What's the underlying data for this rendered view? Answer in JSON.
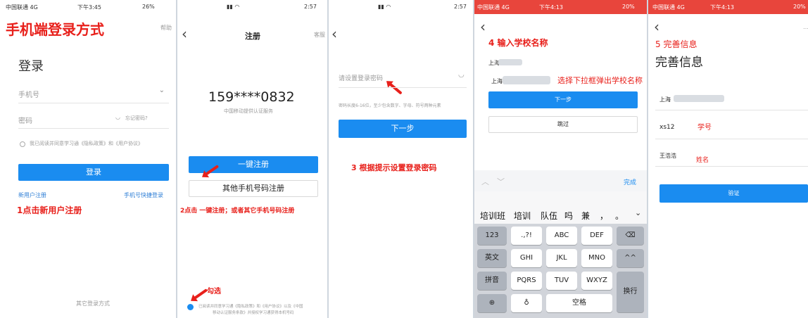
{
  "panel1": {
    "status_left": "中国联通 4G",
    "status_time": "下午3:45",
    "status_right": "26%",
    "header_annotation": "手机端登录方式",
    "top_right_link": "帮助",
    "title": "登录",
    "phone_placeholder": "手机号",
    "password_placeholder": "密码",
    "forgot_password": "忘记密码?",
    "agreement": "我已阅读并同意学习通《隐私政策》和《用户协议》",
    "login_button": "登录",
    "new_user_link": "新用户注册",
    "phone_code_login": "手机号快捷登录",
    "step_annotation": "1点击新用户注册",
    "other_login": "其它登录方式"
  },
  "panel2": {
    "status_right": "2:57",
    "title": "注册",
    "help": "客服",
    "phone_number": "159****0832",
    "carrier_note": "中国移动提供认证服务",
    "one_click_register": "一键注册",
    "other_phone_register": "其他手机号码注册",
    "step_annotation": "2点击 一键注册；或者其它手机号码注册",
    "check_annotation": "勾选",
    "agreement_line1": "已阅读并同意学习通《隐私政策》和《用户协议》以及《中国",
    "agreement_line2": "移动认证服务条款》并授权学习通获得本机号码"
  },
  "panel3": {
    "status_right": "2:57",
    "password_placeholder": "请设置登录密码",
    "password_hint": "密码长度6-16位，至少包含数字、字母、符号两种元素",
    "next_button": "下一步",
    "step_annotation": "3 根据提示设置登录密码"
  },
  "panel4": {
    "status_left": "中国联通 4G",
    "status_time": "下午4:13",
    "status_right": "20%",
    "step_annotation": "4 输入学校名称",
    "school_label": "上海",
    "school_input_prefix": "上海",
    "dropdown_annotation": "选择下拉框弹出学校名称",
    "next_button": "下一步",
    "skip_button": "跳过",
    "keyboard_done": "完成",
    "candidates": [
      "培训班",
      "培训",
      "队伍",
      "吗",
      "兼",
      "，",
      "。"
    ],
    "keys_row1": [
      "123",
      ".,?!",
      "ABC",
      "DEF"
    ],
    "keys_row2": [
      "英文",
      "GHI",
      "JKL",
      "MNO",
      "^^"
    ],
    "keys_row3": [
      "拼音",
      "PQRS",
      "TUV",
      "WXYZ"
    ],
    "space_key": "空格",
    "enter_key": "换行"
  },
  "panel5": {
    "status_left": "中国联通 4G",
    "status_time": "下午4:13",
    "status_right": "20%",
    "step_annotation": "5 完善信息",
    "title": "完善信息",
    "school_value": "上海",
    "student_id_value": "xs12",
    "student_id_annotation": "学号",
    "name_value": "王浩浩",
    "name_annotation": "姓名",
    "verify_button": "验证"
  }
}
